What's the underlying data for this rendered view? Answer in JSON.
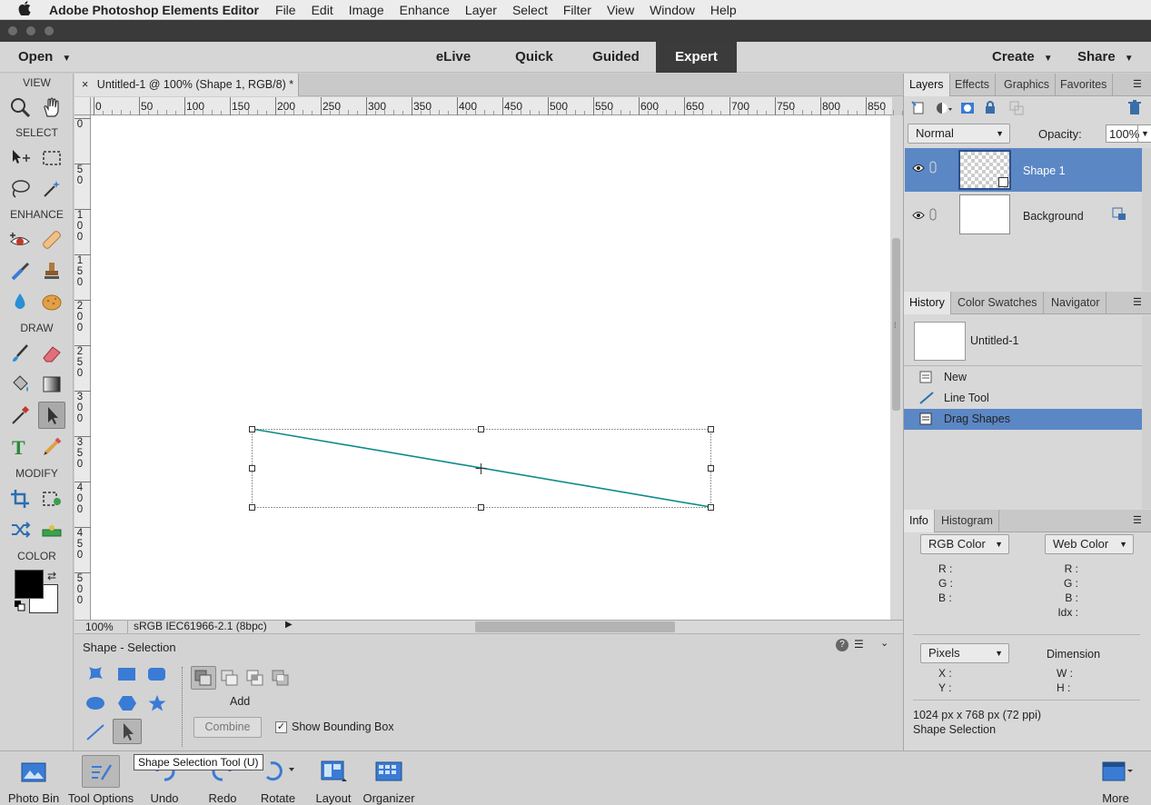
{
  "menubar": {
    "app_name": "Adobe Photoshop Elements Editor",
    "items": [
      "File",
      "Edit",
      "Image",
      "Enhance",
      "Layer",
      "Select",
      "Filter",
      "View",
      "Window",
      "Help"
    ]
  },
  "modebar": {
    "open_label": "Open",
    "modes": [
      "eLive",
      "Quick",
      "Guided",
      "Expert"
    ],
    "active_mode": "Expert",
    "create_label": "Create",
    "share_label": "Share"
  },
  "toolbox": {
    "sections": [
      "VIEW",
      "SELECT",
      "ENHANCE",
      "DRAW",
      "MODIFY",
      "COLOR"
    ],
    "active_tool": "shape-selection-tool",
    "colors": {
      "foreground": "#000000",
      "background": "#ffffff"
    }
  },
  "document": {
    "tab_title": "Untitled-1 @ 100% (Shape 1, RGB/8) *",
    "close_glyph": "×",
    "ruler_h": [
      "0",
      "50",
      "100",
      "150",
      "200",
      "250",
      "300",
      "350",
      "400",
      "450",
      "500",
      "550",
      "600",
      "650",
      "700",
      "750",
      "800",
      "850"
    ],
    "ruler_v": [
      "0",
      "50",
      "100",
      "150",
      "200",
      "250",
      "300",
      "350",
      "400",
      "450",
      "500"
    ],
    "line_color": "#0e8a8a"
  },
  "statusbar": {
    "zoom": "100%",
    "profile": "sRGB IEC61966-2.1 (8bpc)"
  },
  "tool_options": {
    "title": "Shape - Selection",
    "mode_label": "Add",
    "combine_label": "Combine",
    "show_bbox_label": "Show Bounding Box",
    "show_bbox_checked": true
  },
  "tooltip": "Shape Selection Tool (U)",
  "layers_panel": {
    "tabs": [
      "Layers",
      "Effects",
      "Graphics",
      "Favorites"
    ],
    "blend_mode": "Normal",
    "opacity_label": "Opacity:",
    "opacity_value": "100%",
    "layers": [
      {
        "name": "Shape 1",
        "selected": true
      },
      {
        "name": "Background",
        "selected": false
      }
    ]
  },
  "history_panel": {
    "tabs": [
      "History",
      "Color Swatches",
      "Navigator"
    ],
    "snapshot_name": "Untitled-1",
    "items": [
      {
        "label": "New",
        "icon": "new-doc-icon",
        "selected": false
      },
      {
        "label": "Line Tool",
        "icon": "line-tool-icon",
        "selected": false
      },
      {
        "label": "Drag Shapes",
        "icon": "drag-shapes-icon",
        "selected": true
      }
    ]
  },
  "info_panel": {
    "tabs": [
      "Info",
      "Histogram"
    ],
    "color_mode_left": "RGB Color",
    "color_mode_right": "Web Color",
    "rgb_labels_left": [
      "R :",
      "G :",
      "B :"
    ],
    "rgb_labels_right": [
      "R :",
      "G :",
      "B :",
      "Idx :"
    ],
    "units": "Pixels",
    "dimension_label": "Dimension",
    "xy_labels": [
      "X :",
      "Y :"
    ],
    "wh_labels": [
      "W :",
      "H :"
    ],
    "doc_size": "1024 px x 768 px (72 ppi)",
    "tool_name": "Shape Selection"
  },
  "bottombar": {
    "items": [
      "Photo Bin",
      "Tool Options",
      "Undo",
      "Redo",
      "Rotate",
      "Layout",
      "Organizer"
    ],
    "more_label": "More"
  },
  "accent": "#5b87c5"
}
